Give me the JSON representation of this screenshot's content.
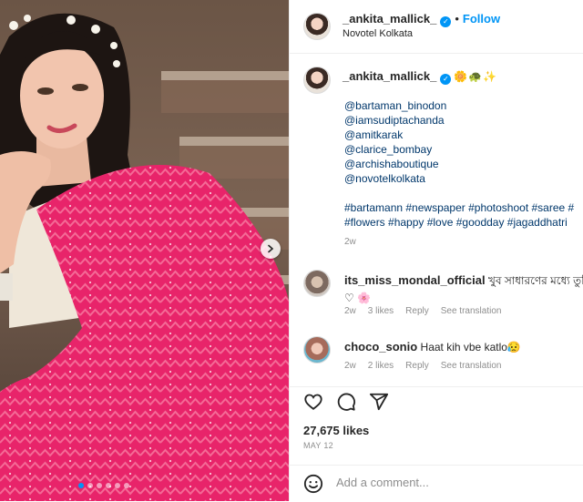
{
  "header": {
    "username": "_ankita_mallick_",
    "separator": "•",
    "follow_label": "Follow",
    "location": "Novotel Kolkata"
  },
  "caption": {
    "username": "_ankita_mallick_",
    "emojis": "🌼🐢✨",
    "mentions": [
      "@bartaman_binodon",
      "@iamsudiptachanda",
      "@amitkarak",
      "@clarice_bombay",
      "@archishaboutique",
      "@novotelkolkata"
    ],
    "hashtags_line1": "#bartamann #newspaper #photoshoot #saree #",
    "hashtags_line2": "#flowers #happy #love #goodday #jagaddhatri",
    "time": "2w"
  },
  "comments": [
    {
      "username": "its_miss_mondal_official",
      "text": "খুব সাধারণের মধ্যে তুমি",
      "text_line2": "♡ 🌸",
      "time": "2w",
      "likes": "3 likes",
      "reply": "Reply",
      "translate": "See translation"
    },
    {
      "username": "choco_sonio",
      "text": "Haat kih vbe katlo😥",
      "time": "2w",
      "likes": "2 likes",
      "reply": "Reply",
      "translate": "See translation"
    }
  ],
  "actions": {
    "likes_count": "27,675 likes",
    "date": "MAY 12"
  },
  "add_comment": {
    "placeholder": "Add a comment..."
  },
  "carousel": {
    "slide_count": 6,
    "active_slide": 1
  },
  "colors": {
    "accent": "#0095f6",
    "link": "#00376b",
    "saree": "#e8246a",
    "muted": "#8e8e8e"
  },
  "icons": {
    "like": "heart-icon",
    "comment": "comment-icon",
    "share": "share-icon",
    "emoji": "smiley-icon",
    "next": "chevron-right-icon",
    "verified": "verified-badge-icon"
  }
}
